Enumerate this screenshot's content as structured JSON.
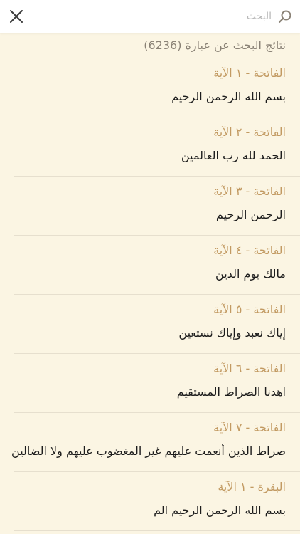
{
  "search": {
    "placeholder": "البحث",
    "value": ""
  },
  "results": {
    "heading": "نتائج البحث عن عبارة (6236)",
    "items": [
      {
        "ref": "الفاتحة - ١ الآية",
        "text": "بسم الله الرحمن الرحيم"
      },
      {
        "ref": "الفاتحة - ٢ الآية",
        "text": "الحمد لله رب العالمين"
      },
      {
        "ref": "الفاتحة - ٣ الآية",
        "text": "الرحمن الرحيم"
      },
      {
        "ref": "الفاتحة - ٤ الآية",
        "text": "مالك يوم الدين"
      },
      {
        "ref": "الفاتحة - ٥ الآية",
        "text": "إياك نعبد وإياك نستعين"
      },
      {
        "ref": "الفاتحة - ٦ الآية",
        "text": "اهدنا الصراط المستقيم"
      },
      {
        "ref": "الفاتحة - ٧ الآية",
        "text": "صراط الذين أنعمت عليهم غير المغضوب عليهم ولا الضالين"
      },
      {
        "ref": "البقرة - ١ الآية",
        "text": "بسم الله الرحمن الرحيم الم"
      }
    ]
  },
  "icons": {
    "close": "close-icon",
    "search": "search-icon"
  },
  "colors": {
    "background": "#fbf5e3",
    "reference": "#c29a62",
    "verse_text": "#1c1c1c",
    "heading": "#8a8276",
    "divider": "#e6dfce",
    "icon": "#3a3a3a",
    "search_icon": "#8a8276"
  }
}
